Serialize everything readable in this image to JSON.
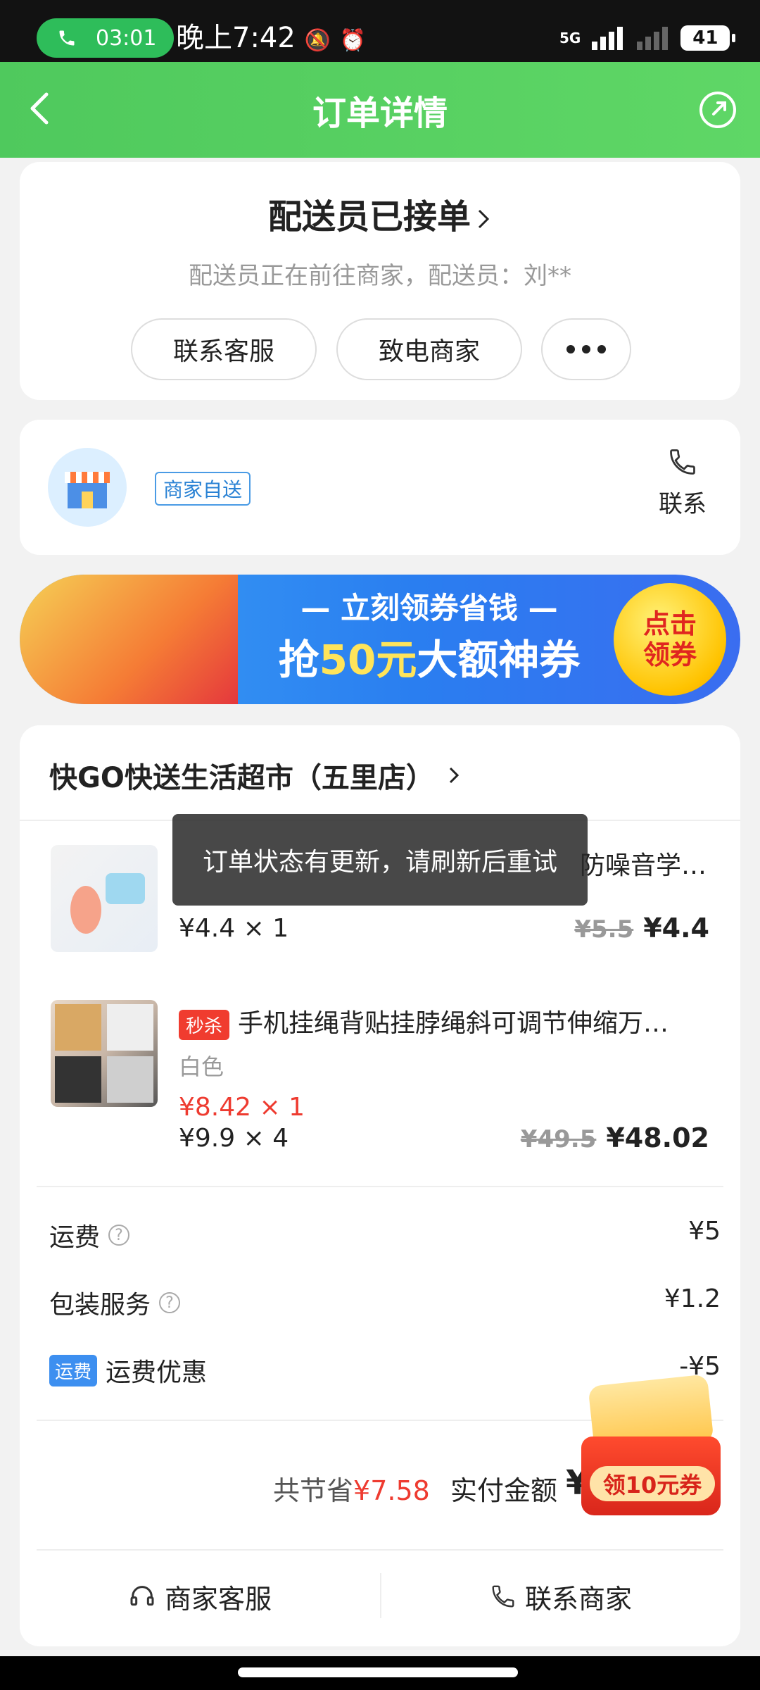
{
  "status_bar": {
    "call_timer": "03:01",
    "time": "晚上7:42",
    "network": "5G",
    "battery": "41"
  },
  "header": {
    "title": "订单详情"
  },
  "order_status": {
    "title": "配送员已接单",
    "subtitle": "配送员正在前往商家，配送员：刘**",
    "buttons": [
      "联系客服",
      "致电商家"
    ]
  },
  "merchant": {
    "delivery_tag": "商家自送",
    "contact_label": "联系"
  },
  "banner": {
    "line1": "— 立刻领券省钱 —",
    "line2_prefix": "抢",
    "line2_amount": "50元",
    "line2_suffix": "大额神券",
    "cta": "点击领券"
  },
  "store": {
    "name": "快GO快送生活超市（五里店）",
    "products": [
      {
        "title": "防噪音学…",
        "qty_text": "¥4.4 × 1",
        "original_price": "¥5.5",
        "price": "¥4.4"
      },
      {
        "badge": "秒杀",
        "title": "手机挂绳背贴挂脖绳斜可调节伸缩万…",
        "variant": "白色",
        "flash_qty_text": "¥8.42 × 1",
        "qty_text": "¥9.9 × 4",
        "original_price": "¥49.5",
        "price": "¥48.02"
      }
    ]
  },
  "fees": {
    "shipping_label": "运费",
    "shipping_value": "¥5",
    "packaging_label": "包装服务",
    "packaging_value": "¥1.2",
    "discount_tag": "运费",
    "discount_label": "运费优惠",
    "discount_value": "-¥5"
  },
  "summary": {
    "saved_label": "共节省",
    "saved_value": "¥7.58",
    "paid_label": "实付金额",
    "paid_value": "¥"
  },
  "coupon_float": {
    "label": "领10元券"
  },
  "bottom_actions": {
    "merchant_service": "商家客服",
    "contact_merchant": "联系商家"
  },
  "toast": {
    "message": "订单状态有更新，请刷新后重试"
  }
}
